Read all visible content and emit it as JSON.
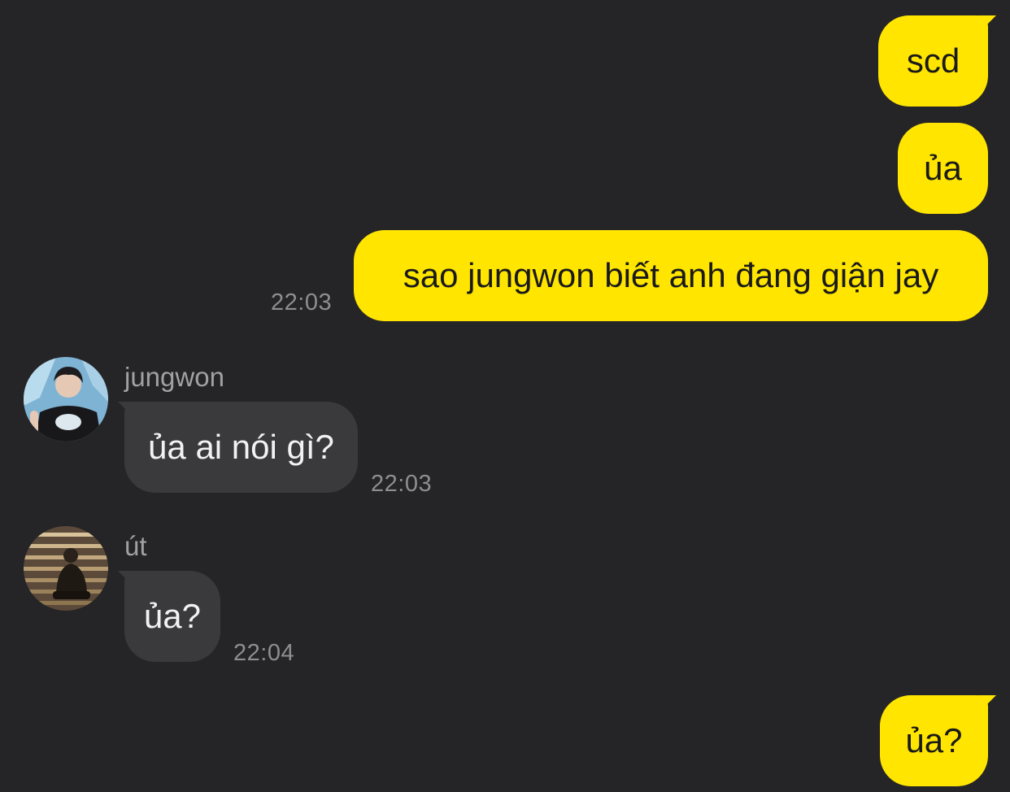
{
  "outgoing": [
    {
      "text": "scd"
    },
    {
      "text": "ủa"
    },
    {
      "text": "sao jungwon biết anh đang giận jay",
      "time": "22:03"
    },
    {
      "text": "ủa?"
    }
  ],
  "incoming": [
    {
      "sender": "jungwon",
      "avatar": "jungwon-avatar",
      "text": "ủa ai nói gì?",
      "time": "22:03"
    },
    {
      "sender": "út",
      "avatar": "ut-avatar",
      "text": "ủa?",
      "time": "22:04"
    }
  ],
  "colors": {
    "background": "#252527",
    "outgoing_bubble": "#ffe500",
    "incoming_bubble": "#3a3a3c",
    "timestamp": "#8e8e92"
  }
}
